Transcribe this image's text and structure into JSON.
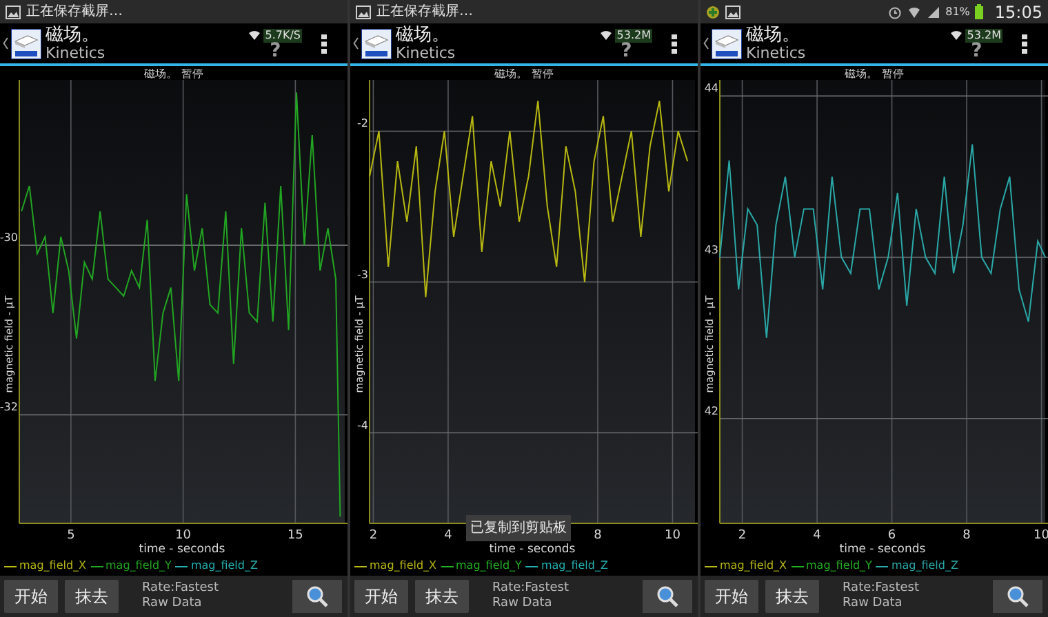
{
  "panels": [
    {
      "status_bar": {
        "kind": "saving",
        "text": "正在保存截屏…"
      },
      "action_bar": {
        "title": "磁场。",
        "subtitle": "Kinetics",
        "net_speed": "5.7K/S",
        "help": "?"
      },
      "chart_status": "磁场。 暂停",
      "chart_data": {
        "type": "line",
        "grid": true,
        "xlabel": "time - seconds",
        "ylabel": "magnetic field - µT",
        "xlim": [
          2.7,
          17.2
        ],
        "ylim": [
          -33.28,
          -28.05
        ],
        "xticks": [
          5,
          10,
          15
        ],
        "yticks": [
          -30,
          -32
        ],
        "x": [
          2.8,
          3.15,
          3.5,
          3.85,
          4.2,
          4.55,
          4.9,
          5.25,
          5.6,
          5.95,
          6.3,
          6.65,
          7.0,
          7.35,
          7.7,
          8.05,
          8.4,
          8.75,
          9.1,
          9.45,
          9.8,
          10.15,
          10.5,
          10.85,
          11.2,
          11.55,
          11.9,
          12.25,
          12.6,
          12.95,
          13.3,
          13.65,
          14.0,
          14.35,
          14.7,
          15.05,
          15.4,
          15.75,
          16.1,
          16.45,
          16.8,
          17.0
        ],
        "series": [
          {
            "name": "mag_field_X",
            "color": "#b8b812",
            "values": [
              null,
              null,
              null,
              null,
              null,
              null,
              null,
              null,
              null,
              null,
              null,
              null,
              null,
              null,
              null,
              null,
              null,
              null,
              null,
              null,
              null,
              null,
              null,
              null,
              null,
              null,
              null,
              null,
              null,
              null,
              null,
              null,
              null,
              null,
              null,
              null,
              null,
              null,
              null,
              null,
              null,
              null
            ]
          },
          {
            "name": "mag_field_Y",
            "color": "#22a522",
            "values": [
              -29.6,
              -29.3,
              -30.1,
              -29.9,
              -30.8,
              -29.9,
              -30.3,
              -31.1,
              -30.2,
              -30.4,
              -29.6,
              -30.4,
              -30.5,
              -30.6,
              -30.3,
              -30.5,
              -29.7,
              -31.6,
              -30.8,
              -30.5,
              -31.6,
              -29.4,
              -30.3,
              -29.8,
              -30.7,
              -30.8,
              -29.6,
              -31.4,
              -29.8,
              -30.8,
              -30.9,
              -29.5,
              -30.9,
              -29.3,
              -31.0,
              -28.2,
              -30.0,
              -28.7,
              -30.3,
              -29.8,
              -30.4,
              -33.2
            ]
          },
          {
            "name": "mag_field_Z",
            "color": "#22b0b0",
            "values": [
              null,
              null,
              null,
              null,
              null,
              null,
              null,
              null,
              null,
              null,
              null,
              null,
              null,
              null,
              null,
              null,
              null,
              null,
              null,
              null,
              null,
              null,
              null,
              null,
              null,
              null,
              null,
              null,
              null,
              null,
              null,
              null,
              null,
              null,
              null,
              null,
              null,
              null,
              null,
              null,
              null,
              null
            ]
          }
        ]
      },
      "buttons": [
        "开始",
        "抹去"
      ],
      "rate": "Rate:Fastest",
      "mode": "Raw Data"
    },
    {
      "status_bar": {
        "kind": "saving",
        "text": "正在保存截屏…"
      },
      "action_bar": {
        "title": "磁场。",
        "subtitle": "Kinetics",
        "net_speed": "53.2M",
        "help": "?"
      },
      "chart_status": "磁场。 暂停",
      "chart_data": {
        "type": "line",
        "grid": true,
        "xlabel": "time - seconds",
        "ylabel": "magnetic field - µT",
        "xlim": [
          1.9,
          10.6
        ],
        "ylim": [
          -4.6,
          -1.66
        ],
        "xticks": [
          2,
          4,
          8,
          10
        ],
        "yticks": [
          -2,
          -3,
          -4
        ],
        "x": [
          1.9,
          2.15,
          2.4,
          2.65,
          2.9,
          3.15,
          3.4,
          3.65,
          3.9,
          4.15,
          4.4,
          4.65,
          4.9,
          5.15,
          5.4,
          5.65,
          5.9,
          6.15,
          6.4,
          6.65,
          6.9,
          7.15,
          7.4,
          7.65,
          7.9,
          8.15,
          8.4,
          8.65,
          8.9,
          9.15,
          9.4,
          9.65,
          9.9,
          10.15,
          10.4
        ],
        "series": [
          {
            "name": "mag_field_X",
            "color": "#b8b812",
            "values": [
              -2.3,
              -2.0,
              -2.9,
              -2.2,
              -2.6,
              -2.1,
              -3.1,
              -2.4,
              -2.0,
              -2.7,
              -2.3,
              -1.9,
              -2.8,
              -2.2,
              -2.5,
              -2.0,
              -2.6,
              -2.3,
              -1.8,
              -2.5,
              -2.9,
              -2.1,
              -2.4,
              -3.0,
              -2.2,
              -1.9,
              -2.6,
              -2.3,
              -2.0,
              -2.7,
              -2.1,
              -1.8,
              -2.4,
              -2.0,
              -2.2
            ]
          },
          {
            "name": "mag_field_Y",
            "color": "#22b022",
            "values": [
              null,
              null,
              null,
              null,
              null,
              null,
              null,
              null,
              null,
              null,
              null,
              null,
              null,
              null,
              null,
              null,
              null,
              null,
              null,
              null,
              null,
              null,
              null,
              null,
              null,
              null,
              null,
              null,
              null,
              null,
              null,
              null,
              null,
              null,
              null
            ]
          },
          {
            "name": "mag_field_Z",
            "color": "#22b0b0",
            "values": [
              null,
              null,
              null,
              null,
              null,
              null,
              null,
              null,
              null,
              null,
              null,
              null,
              null,
              null,
              null,
              null,
              null,
              null,
              null,
              null,
              null,
              null,
              null,
              null,
              null,
              null,
              null,
              null,
              null,
              null,
              null,
              null,
              null,
              null,
              null
            ]
          }
        ]
      },
      "buttons": [
        "开始",
        "抹去"
      ],
      "rate": "Rate:Fastest",
      "mode": "Raw Data",
      "toast": "已复制到剪贴板"
    },
    {
      "status_bar": {
        "kind": "system",
        "battery": "81%",
        "time": "15:05"
      },
      "action_bar": {
        "title": "磁场。",
        "subtitle": "Kinetics",
        "net_speed": "53.2M",
        "help": "?"
      },
      "chart_status": "磁场。 暂停",
      "chart_data": {
        "type": "line",
        "grid": true,
        "xlabel": "time - seconds",
        "ylabel": "magnetic field - µT",
        "xlim": [
          1.4,
          10.1
        ],
        "ylim": [
          41.35,
          44.1
        ],
        "xticks": [
          2,
          4,
          6,
          8,
          10
        ],
        "yticks": [
          44,
          43,
          42
        ],
        "x": [
          1.4,
          1.65,
          1.9,
          2.15,
          2.4,
          2.65,
          2.9,
          3.15,
          3.4,
          3.65,
          3.9,
          4.15,
          4.4,
          4.65,
          4.9,
          5.15,
          5.4,
          5.65,
          5.9,
          6.15,
          6.4,
          6.65,
          6.9,
          7.15,
          7.4,
          7.65,
          7.9,
          8.15,
          8.4,
          8.65,
          8.9,
          9.15,
          9.4,
          9.65,
          9.9,
          10.1
        ],
        "series": [
          {
            "name": "mag_field_X",
            "color": "#b8b812",
            "values": [
              null,
              null,
              null,
              null,
              null,
              null,
              null,
              null,
              null,
              null,
              null,
              null,
              null,
              null,
              null,
              null,
              null,
              null,
              null,
              null,
              null,
              null,
              null,
              null,
              null,
              null,
              null,
              null,
              null,
              null,
              null,
              null,
              null,
              null,
              null,
              null
            ]
          },
          {
            "name": "mag_field_Y",
            "color": "#22b022",
            "values": [
              null,
              null,
              null,
              null,
              null,
              null,
              null,
              null,
              null,
              null,
              null,
              null,
              null,
              null,
              null,
              null,
              null,
              null,
              null,
              null,
              null,
              null,
              null,
              null,
              null,
              null,
              null,
              null,
              null,
              null,
              null,
              null,
              null,
              null,
              null,
              null
            ]
          },
          {
            "name": "mag_field_Z",
            "color": "#2aa8a8",
            "values": [
              43.0,
              43.6,
              42.8,
              43.3,
              43.2,
              42.5,
              43.2,
              43.5,
              43.0,
              43.3,
              43.3,
              42.8,
              43.5,
              43.0,
              42.9,
              43.3,
              43.3,
              42.8,
              43.0,
              43.4,
              42.7,
              43.3,
              43.0,
              42.9,
              43.5,
              42.9,
              43.2,
              43.7,
              43.0,
              42.9,
              43.3,
              43.5,
              42.8,
              42.6,
              43.1,
              43.0
            ]
          }
        ]
      },
      "buttons": [
        "开始",
        "抹去"
      ],
      "rate": "Rate:Fastest",
      "mode": "Raw Data"
    }
  ]
}
